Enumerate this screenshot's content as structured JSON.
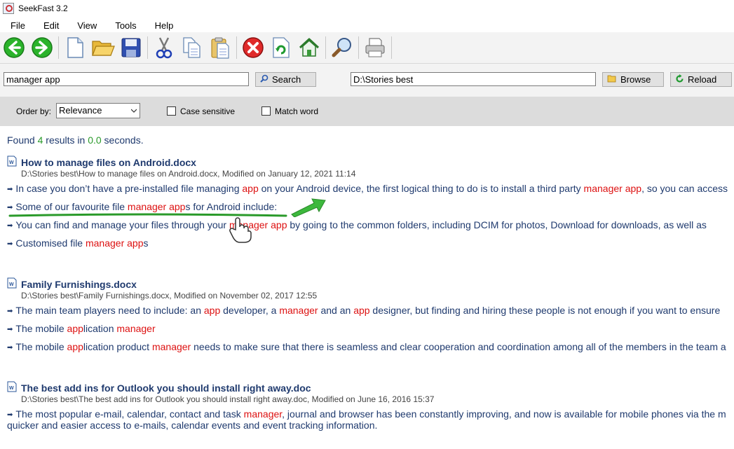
{
  "window": {
    "title": "SeekFast 3.2"
  },
  "menu": [
    "File",
    "Edit",
    "View",
    "Tools",
    "Help"
  ],
  "toolbar": {
    "buttons": [
      "back-icon",
      "forward-icon",
      "new-document-icon",
      "open-folder-icon",
      "save-icon",
      "cut-icon",
      "copy-icon",
      "paste-icon",
      "stop-icon",
      "refresh-icon",
      "home-icon",
      "find-icon",
      "print-icon"
    ]
  },
  "search": {
    "query": "manager app",
    "button": "Search",
    "folder": "D:\\Stories best",
    "browse": "Browse",
    "reload": "Reload"
  },
  "options": {
    "order_label": "Order by:",
    "order_value": "Relevance",
    "case_sensitive": "Case sensitive",
    "match_word": "Match word"
  },
  "summary": {
    "prefix": "Found ",
    "count": "4",
    "mid": " results in ",
    "time": "0.0",
    "suffix": " seconds."
  },
  "results": [
    {
      "title": "How to manage files on Android.docx",
      "path": "D:\\Stories best\\How to manage files on Android.docx, Modified on January 12, 2021 11:14",
      "lines": [
        [
          [
            "In case you don’t have a pre-installed file managing ",
            false
          ],
          [
            "app",
            true
          ],
          [
            " on your Android device, the first logical thing to do is to install a third party ",
            false
          ],
          [
            "manager",
            true
          ],
          [
            " ",
            false
          ],
          [
            "app",
            true
          ],
          [
            ", so you can access",
            false
          ]
        ],
        [
          [
            "Some of our favourite file ",
            false
          ],
          [
            "manager",
            true
          ],
          [
            " ",
            false
          ],
          [
            "app",
            true
          ],
          [
            "s for Android include:",
            false
          ]
        ],
        [
          [
            "You can find and manage your files through your ",
            false
          ],
          [
            "manager",
            true
          ],
          [
            " ",
            false
          ],
          [
            "app",
            true
          ],
          [
            " by going to the common folders, including DCIM for photos, Download for downloads, as well as",
            false
          ]
        ],
        [
          [
            "Customised file ",
            false
          ],
          [
            "manager",
            true
          ],
          [
            " ",
            false
          ],
          [
            "app",
            true
          ],
          [
            "s",
            false
          ]
        ]
      ]
    },
    {
      "title": "Family Furnishings.docx",
      "path": "D:\\Stories best\\Family Furnishings.docx, Modified on November 02, 2017 12:55",
      "lines": [
        [
          [
            "The main team players need to include: an ",
            false
          ],
          [
            "app",
            true
          ],
          [
            " developer, a ",
            false
          ],
          [
            "manager",
            true
          ],
          [
            " and an ",
            false
          ],
          [
            "app",
            true
          ],
          [
            " designer, but finding and hiring these people is not enough if you want to ensure",
            false
          ]
        ],
        [
          [
            "The mobile ",
            false
          ],
          [
            "app",
            true
          ],
          [
            "lication ",
            false
          ],
          [
            "manager",
            true
          ]
        ],
        [
          [
            "The mobile ",
            false
          ],
          [
            "app",
            true
          ],
          [
            "lication product ",
            false
          ],
          [
            "manager",
            true
          ],
          [
            " needs to make sure that there is seamless and clear cooperation and coordination among all of the members in the team a",
            false
          ]
        ]
      ]
    },
    {
      "title": "The best add ins for Outlook you should install right away.doc",
      "path": "D:\\Stories best\\The best add ins for Outlook you should install right away.doc, Modified on June 16, 2016 15:37",
      "lines": [
        [
          [
            "The most popular e-mail, calendar, contact and task ",
            false
          ],
          [
            "manager",
            true
          ],
          [
            ", journal and browser has been constantly improving, and now is available for mobile phones via the m",
            false
          ]
        ]
      ],
      "continuation": "quicker and easier access to e-mails, calendar events and event tracking information."
    }
  ]
}
